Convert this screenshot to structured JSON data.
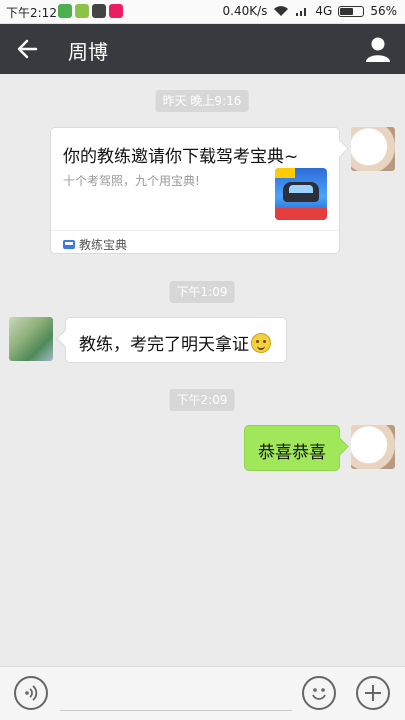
{
  "status_bar": {
    "time": "下午2:12",
    "network_speed": "0.40K/s",
    "network_type": "4G",
    "battery_percent": "56%",
    "battery_level": 0.56
  },
  "header": {
    "title": "周博",
    "back_icon": "arrow-left-icon",
    "profile_icon": "person-icon"
  },
  "messages": {
    "ts1": "昨天 晚上9:16",
    "card": {
      "title": "你的教练邀请你下载驾考宝典~",
      "desc": "十个考驾照，九个用宝典!",
      "source": "教练宝典"
    },
    "ts2": "下午1:09",
    "incoming": "教练，考完了明天拿证",
    "ts3": "下午2:09",
    "outgoing": "恭喜恭喜"
  },
  "colors": {
    "titlebar": "#393a3f",
    "chat_bg": "#ebebeb",
    "outgoing_bubble": "#a0e75a"
  }
}
